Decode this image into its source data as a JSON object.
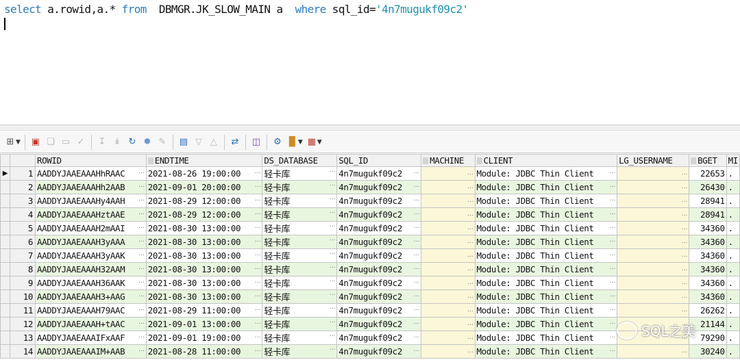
{
  "editor": {
    "sql_select": "select",
    "sql_cols": " a.rowid,a.* ",
    "sql_from": "from",
    "sql_table": "  DBMGR.JK_SLOW_MAIN a  ",
    "sql_where": "where",
    "sql_cond": " sql_id=",
    "sql_value": "'4n7mugukf09c2'"
  },
  "toolbar": {
    "icons": [
      "grid-menu-icon",
      "lock-icon",
      "add-row-icon",
      "delete-row-icon",
      "post-icon",
      "next-record-icon",
      "last-record-icon",
      "refresh-icon",
      "find-icon",
      "clear-icon",
      "export-icon",
      "filter-icon",
      "sort-icon",
      "record-icon",
      "save-icon",
      "query-icon",
      "chart-icon",
      "table-icon"
    ]
  },
  "grid": {
    "columns": [
      "ROWID",
      "ENDTIME",
      "DS_DATABASE",
      "SQL_ID",
      "MACHINE",
      "CLIENT",
      "LG_USERNAME",
      "BGET",
      "MI"
    ],
    "rows": [
      {
        "n": "1",
        "rowid": "AADDYJAAEAAAHhRAAC",
        "endtime": "2021-08-26 19:00:00",
        "db": "轻卡库",
        "sql_id": "4n7mugukf09c2",
        "machine": "",
        "client": "Module: JDBC Thin Client",
        "lg": "",
        "bget": "22653",
        "mi": "."
      },
      {
        "n": "2",
        "rowid": "AADDYJAAEAAAHh2AAB",
        "endtime": "2021-09-01 20:00:00",
        "db": "轻卡库",
        "sql_id": "4n7mugukf09c2",
        "machine": "",
        "client": "Module: JDBC Thin Client",
        "lg": "",
        "bget": "26430",
        "mi": "."
      },
      {
        "n": "3",
        "rowid": "AADDYJAAEAAAHy4AAH",
        "endtime": "2021-08-29 12:00:00",
        "db": "轻卡库",
        "sql_id": "4n7mugukf09c2",
        "machine": "",
        "client": "Module: JDBC Thin Client",
        "lg": "",
        "bget": "28941",
        "mi": "."
      },
      {
        "n": "4",
        "rowid": "AADDYJAAEAAAHztAAE",
        "endtime": "2021-08-29 12:00:00",
        "db": "轻卡库",
        "sql_id": "4n7mugukf09c2",
        "machine": "",
        "client": "Module: JDBC Thin Client",
        "lg": "",
        "bget": "28941",
        "mi": "."
      },
      {
        "n": "5",
        "rowid": "AADDYJAAEAAAH2mAAI",
        "endtime": "2021-08-30 13:00:00",
        "db": "轻卡库",
        "sql_id": "4n7mugukf09c2",
        "machine": "",
        "client": "Module: JDBC Thin Client",
        "lg": "",
        "bget": "34360",
        "mi": "."
      },
      {
        "n": "6",
        "rowid": "AADDYJAAEAAAH3yAAA",
        "endtime": "2021-08-30 13:00:00",
        "db": "轻卡库",
        "sql_id": "4n7mugukf09c2",
        "machine": "",
        "client": "Module: JDBC Thin Client",
        "lg": "",
        "bget": "34360",
        "mi": "."
      },
      {
        "n": "7",
        "rowid": "AADDYJAAEAAAH3yAAK",
        "endtime": "2021-08-30 13:00:00",
        "db": "轻卡库",
        "sql_id": "4n7mugukf09c2",
        "machine": "",
        "client": "Module: JDBC Thin Client",
        "lg": "",
        "bget": "34360",
        "mi": "."
      },
      {
        "n": "8",
        "rowid": "AADDYJAAEAAAH32AAM",
        "endtime": "2021-08-30 13:00:00",
        "db": "轻卡库",
        "sql_id": "4n7mugukf09c2",
        "machine": "",
        "client": "Module: JDBC Thin Client",
        "lg": "",
        "bget": "34360",
        "mi": "."
      },
      {
        "n": "9",
        "rowid": "AADDYJAAEAAAH36AAK",
        "endtime": "2021-08-30 13:00:00",
        "db": "轻卡库",
        "sql_id": "4n7mugukf09c2",
        "machine": "",
        "client": "Module: JDBC Thin Client",
        "lg": "",
        "bget": "34360",
        "mi": "."
      },
      {
        "n": "10",
        "rowid": "AADDYJAAEAAAH3+AAG",
        "endtime": "2021-08-30 13:00:00",
        "db": "轻卡库",
        "sql_id": "4n7mugukf09c2",
        "machine": "",
        "client": "Module: JDBC Thin Client",
        "lg": "",
        "bget": "34360",
        "mi": "."
      },
      {
        "n": "11",
        "rowid": "AADDYJAAEAAAH79AAC",
        "endtime": "2021-08-29 11:00:00",
        "db": "轻卡库",
        "sql_id": "4n7mugukf09c2",
        "machine": "",
        "client": "Module: JDBC Thin Client",
        "lg": "",
        "bget": "26262",
        "mi": "."
      },
      {
        "n": "12",
        "rowid": "AADDYJAAEAAAH+tAAC",
        "endtime": "2021-09-01 13:00:00",
        "db": "轻卡库",
        "sql_id": "4n7mugukf09c2",
        "machine": "",
        "client": "Module: JDBC Thin Client",
        "lg": "",
        "bget": "21144",
        "mi": "."
      },
      {
        "n": "13",
        "rowid": "AADDYJAAEAAAIFxAAF",
        "endtime": "2021-09-01 19:00:00",
        "db": "轻卡库",
        "sql_id": "4n7mugukf09c2",
        "machine": "",
        "client": "Module: JDBC Thin Client",
        "lg": "",
        "bget": "79290",
        "mi": "."
      },
      {
        "n": "14",
        "rowid": "AADDYJAAEAAAIM+AAB",
        "endtime": "2021-08-28 11:00:00",
        "db": "轻卡库",
        "sql_id": "4n7mugukf09c2",
        "machine": "",
        "client": "Module: JDBC Thin Client",
        "lg": "",
        "bget": "30240",
        "mi": "."
      }
    ]
  },
  "watermark": {
    "text": "SQL之美"
  }
}
